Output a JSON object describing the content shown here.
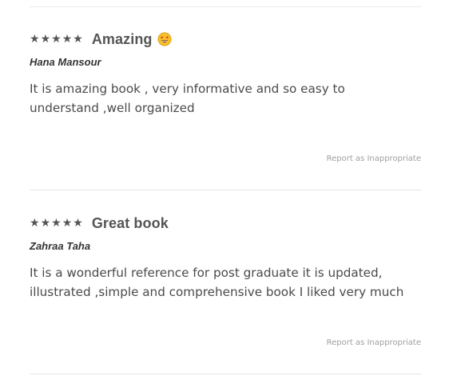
{
  "reviews": [
    {
      "rating": 5,
      "title": "Amazing",
      "emoji": "star-struck-emoji",
      "reviewer": "Hana Mansour",
      "body": "It is amazing book , very informative and so easy to understand ,well organized",
      "report_label": "Report as Inappropriate"
    },
    {
      "rating": 5,
      "title": "Great book",
      "reviewer": "Zahraa Taha",
      "body": "It is a wonderful reference for post graduate it is updated, illustrated ,simple and comprehensive book I liked very much",
      "report_label": "Report as Inappropriate"
    }
  ],
  "colors": {
    "star": "#555555",
    "title": "#555555",
    "body_text": "#4a4a4a",
    "report_link": "#a0a0a0",
    "divider": "#e8e8e8",
    "emoji_face": "#f7c12a"
  }
}
